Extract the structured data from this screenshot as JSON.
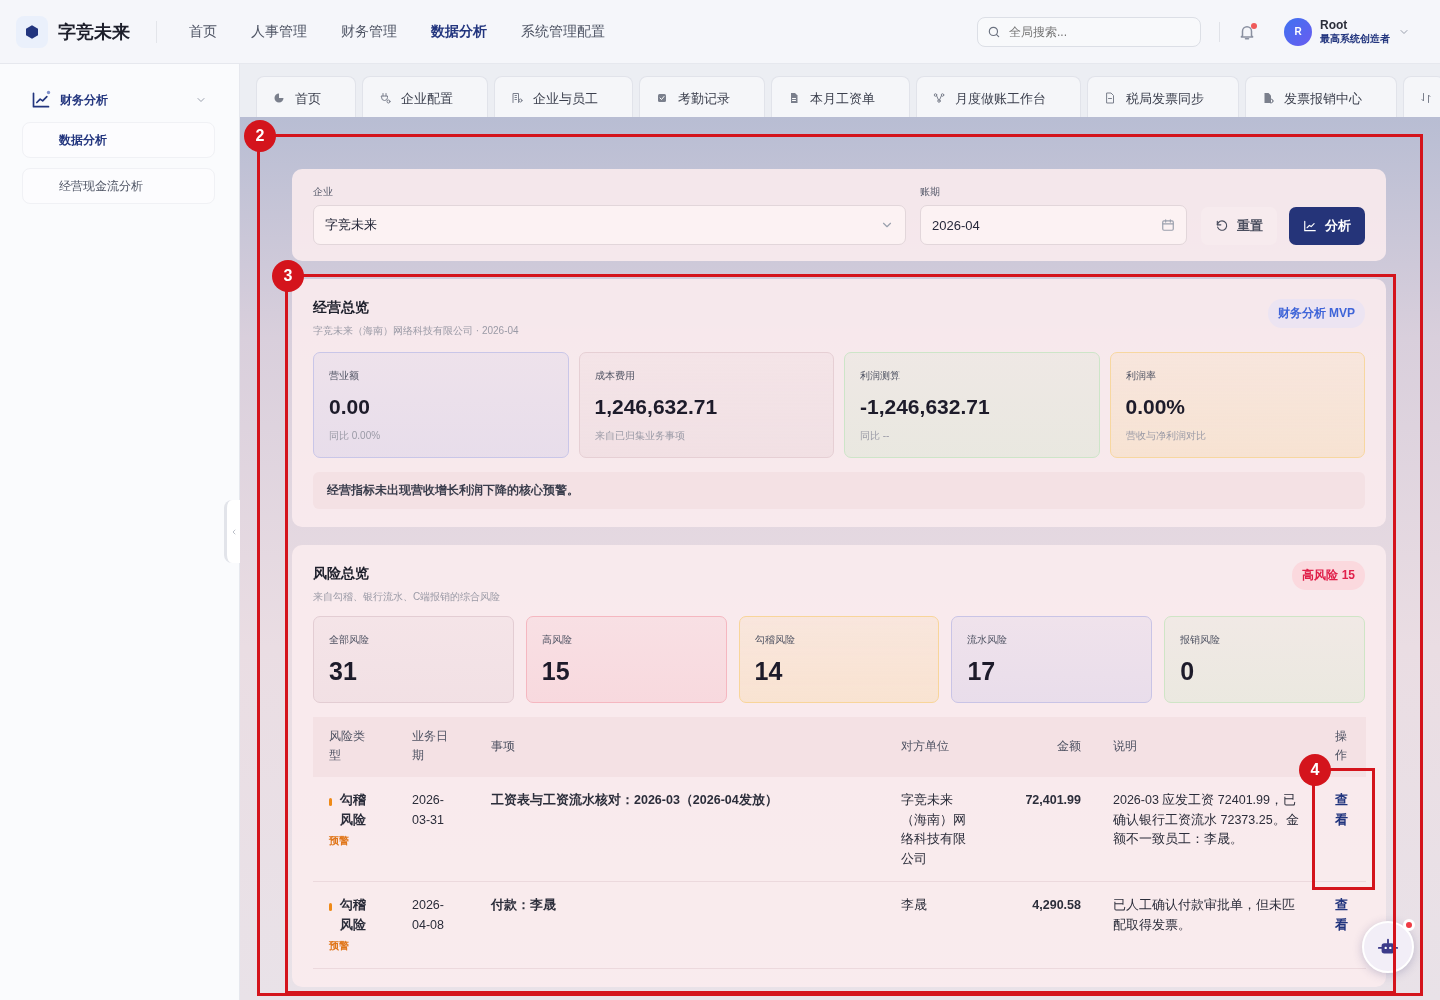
{
  "app": {
    "name": "字竞未来"
  },
  "nav": [
    {
      "label": "首页",
      "selected": false
    },
    {
      "label": "人事管理",
      "selected": false
    },
    {
      "label": "财务管理",
      "selected": false
    },
    {
      "label": "数据分析",
      "selected": true
    },
    {
      "label": "系统管理配置",
      "selected": false
    }
  ],
  "search": {
    "placeholder": "全局搜索..."
  },
  "notifications": {
    "unread": true
  },
  "user": {
    "avatar": "R",
    "name": "Root",
    "role": "最高系统创造者"
  },
  "sidebar": {
    "group": {
      "label": "财务分析",
      "expanded": true,
      "children": [
        {
          "label": "数据分析",
          "selected": true
        },
        {
          "label": "经营现金流分析",
          "selected": false
        }
      ]
    }
  },
  "tabs": [
    {
      "label": "首页",
      "selected": false
    },
    {
      "label": "企业配置",
      "selected": false
    },
    {
      "label": "企业与员工",
      "selected": false
    },
    {
      "label": "考勤记录",
      "selected": false
    },
    {
      "label": "本月工资单",
      "selected": false
    },
    {
      "label": "月度做账工作台",
      "selected": false
    },
    {
      "label": "税局发票同步",
      "selected": false
    },
    {
      "label": "发票报销中心",
      "selected": false
    },
    {
      "selected": false
    }
  ],
  "filters": {
    "company_label": "企业",
    "company_value": "字竞未来",
    "period_label": "账期",
    "period_value": "2026-04",
    "reset_button": "重置",
    "analyze_button": "分析"
  },
  "overview": {
    "title": "经营总览",
    "subtitle": "字竞未来（海南）网络科技有限公司 · 2026-04",
    "badge": "财务分析 MVP",
    "cards": [
      {
        "label": "营业额",
        "value": "0.00",
        "note": "同比 0.00%",
        "color": "#c9c6e8"
      },
      {
        "label": "成本费用",
        "value": "1,246,632.71",
        "note": "来自已归集业务事项",
        "color": "#e6cfd4"
      },
      {
        "label": "利润测算",
        "value": "-1,246,632.71",
        "note": "同比 --",
        "color": "#cde5c8"
      },
      {
        "label": "利润率",
        "value": "0.00%",
        "note": "营收与净利润对比",
        "color": "#f7d7a0"
      }
    ],
    "notice": "经营指标未出现营收增长利润下降的核心预警。"
  },
  "risk": {
    "title": "风险总览",
    "subtitle": "来自勾稽、银行流水、C端报销的综合风险",
    "badge": "高风险 15",
    "cards": [
      {
        "label": "全部风险",
        "value": "31",
        "color": "#e3cdd3"
      },
      {
        "label": "高风险",
        "value": "15",
        "color": "#f5b7c0"
      },
      {
        "label": "勾稽风险",
        "value": "14",
        "color": "#f8d59a"
      },
      {
        "label": "流水风险",
        "value": "17",
        "color": "#c9c4e6"
      },
      {
        "label": "报销风险",
        "value": "0",
        "color": "#cfe5c6"
      }
    ],
    "table": {
      "columns": [
        "风险类型",
        "业务日期",
        "事项",
        "对方单位",
        "金额",
        "说明",
        "操作"
      ],
      "rows": [
        {
          "type": "勾稽风险",
          "level": "预警",
          "date": "2026-03-31",
          "item": "工资表与工资流水核对：2026-03（2026-04发放）",
          "party": "字竞未来（海南）网络科技有限公司",
          "amount": "72,401.99",
          "description": "2026-03 应发工资 72401.99，已确认银行工资流水 72373.25。金额不一致员工：李晟。",
          "action": "查看"
        },
        {
          "type": "勾稽风险",
          "level": "预警",
          "date": "2026-04-08",
          "item": "付款：李晟",
          "party": "李晟",
          "amount": "4,290.58",
          "description": "已人工确认付款审批单，但未匹配取得发票。",
          "action": "查看"
        }
      ]
    }
  },
  "assistant": {
    "unread": true
  },
  "annotations": [
    {
      "number": "2"
    },
    {
      "number": "3"
    },
    {
      "number": "4"
    }
  ]
}
